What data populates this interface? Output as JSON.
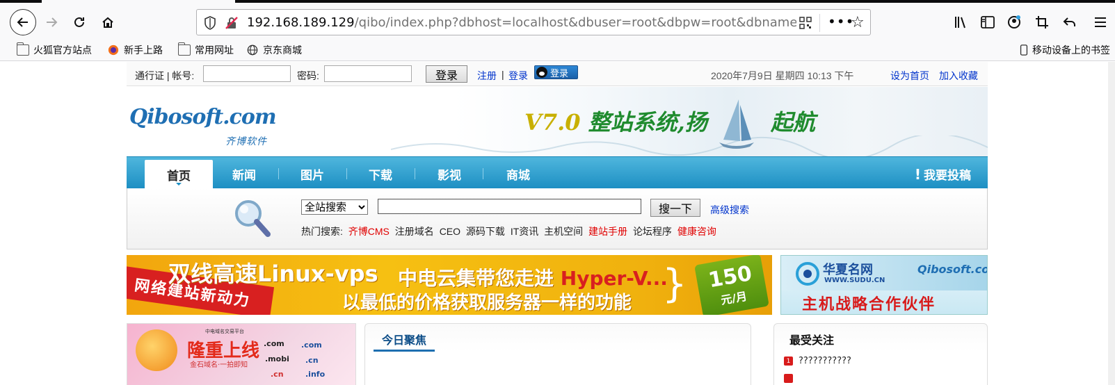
{
  "browser": {
    "url_host": "192.168.189.129",
    "url_path": "/qibo/index.php?dbhost=localhost&dbuser=root&dbpw=root&dbname=qibo",
    "bookmarks": [
      {
        "label": "火狐官方站点",
        "icon": "folder-icon"
      },
      {
        "label": "新手上路",
        "icon": "firefox-icon"
      },
      {
        "label": "常用网址",
        "icon": "folder-icon"
      },
      {
        "label": "京东商城",
        "icon": "globe-icon"
      }
    ],
    "mobile_bookmarks": "移动设备上的书签"
  },
  "loginbar": {
    "passport_label": "通行证 | 帐号:",
    "password_label": "密码:",
    "login_button": "登录",
    "register_link": "注册",
    "pipe": "|",
    "login_link": "登录",
    "qq_login": "登录",
    "date_text": "2020年7月9日  星期四  10:13  下午",
    "set_home": "设为首页",
    "add_fav": "加入收藏"
  },
  "header": {
    "logo_text": "Qibosoft.com",
    "logo_cn": "齐博软件",
    "slogan_version": "V7.0",
    "slogan_part1": "整站系统,扬",
    "slogan_part2": "起航"
  },
  "nav": {
    "items": [
      "首页",
      "新闻",
      "图片",
      "下载",
      "影视",
      "商城"
    ],
    "post": "我要投稿"
  },
  "search": {
    "scope_selected": "全站搜索",
    "submit": "搜一下",
    "advanced": "高级搜索",
    "hot_label": "热门搜索:",
    "hot_terms": [
      {
        "text": "齐博CMS",
        "red": true
      },
      {
        "text": "注册域名",
        "red": false
      },
      {
        "text": "CEO",
        "red": false
      },
      {
        "text": "源码下载",
        "red": false
      },
      {
        "text": "IT资讯",
        "red": false
      },
      {
        "text": "主机空间",
        "red": false
      },
      {
        "text": "建站手册",
        "red": true
      },
      {
        "text": "论坛程序",
        "red": false
      },
      {
        "text": "健康咨询",
        "red": true
      }
    ]
  },
  "ads": {
    "vps_title": "双线高速Linux-vps",
    "vps_ribbon": "网络建站新动力",
    "vps_line2_a": "中电云集带您走进",
    "vps_line2_b": "Hyper-V...",
    "vps_line3": "以最低的价格获取服务器一样的功能",
    "vps_price": "150",
    "vps_unit": "元/月",
    "sudu_name": "华夏名网",
    "sudu_www": "WWW.SUDU.CN",
    "sudu_partner_logo": "Qibosoft.com",
    "sudu_slogan": "主机战略合作伙伴"
  },
  "promo": {
    "big": "隆重上线",
    "tiny": "中电域名交易平台",
    "small": "金石域名·一拍即知",
    "domains": [
      ".com",
      ".com",
      ".mobi",
      ".cn",
      ".cn",
      ".info"
    ]
  },
  "panels": {
    "today_focus": "今日聚焦",
    "most_followed": "最受关注",
    "rank1_num": "1",
    "rank1_text": "???????????"
  }
}
